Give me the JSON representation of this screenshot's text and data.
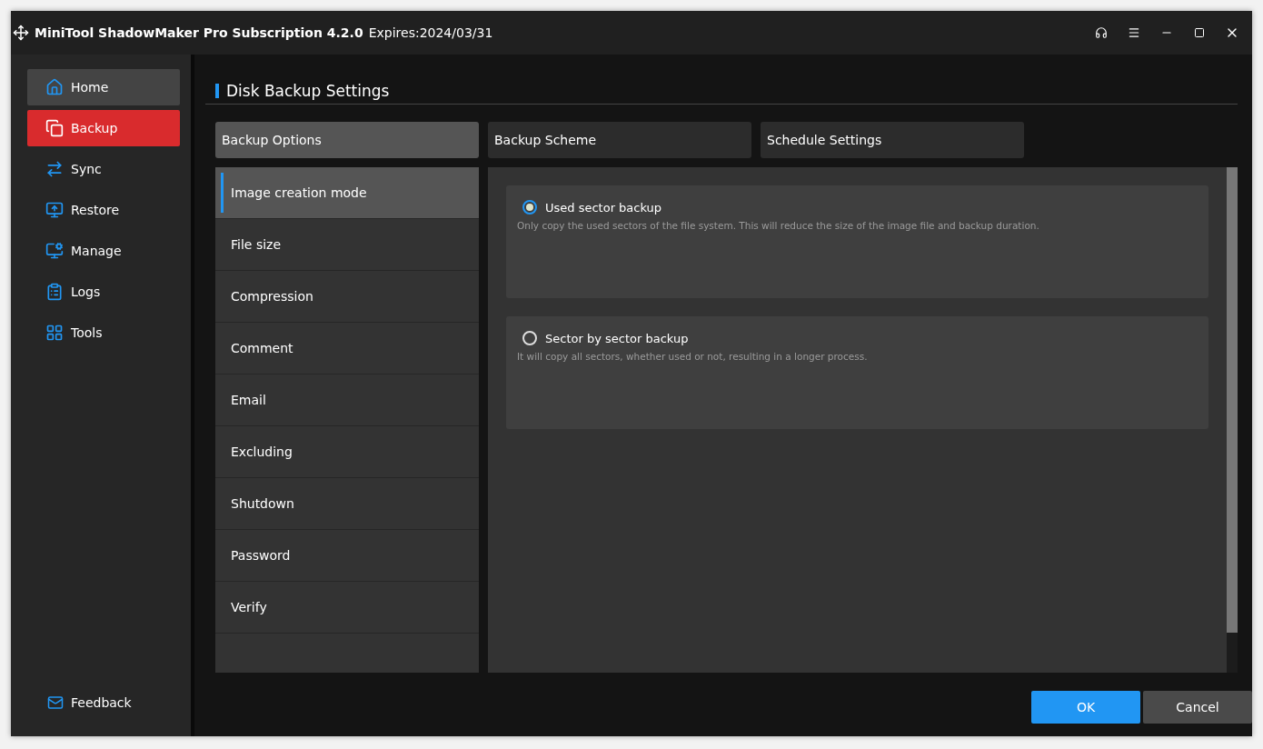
{
  "window": {
    "title": "MiniTool ShadowMaker Pro Subscription 4.2.0",
    "expiry": "Expires:2024/03/31"
  },
  "sidebar": {
    "items": [
      {
        "label": "Home",
        "selected": false,
        "hovered": true
      },
      {
        "label": "Backup",
        "selected": true,
        "hovered": false
      },
      {
        "label": "Sync",
        "selected": false,
        "hovered": false
      },
      {
        "label": "Restore",
        "selected": false,
        "hovered": false
      },
      {
        "label": "Manage",
        "selected": false,
        "hovered": false
      },
      {
        "label": "Logs",
        "selected": false,
        "hovered": false
      },
      {
        "label": "Tools",
        "selected": false,
        "hovered": false
      }
    ],
    "feedback": "Feedback"
  },
  "heading": "Disk Backup Settings",
  "tabs": [
    {
      "label": "Backup Options",
      "selected": true
    },
    {
      "label": "Backup Scheme",
      "selected": false
    },
    {
      "label": "Schedule Settings",
      "selected": false
    }
  ],
  "options_list": [
    {
      "label": "Image creation mode",
      "selected": true
    },
    {
      "label": "File size",
      "selected": false
    },
    {
      "label": "Compression",
      "selected": false
    },
    {
      "label": "Comment",
      "selected": false
    },
    {
      "label": "Email",
      "selected": false
    },
    {
      "label": "Excluding",
      "selected": false
    },
    {
      "label": "Shutdown",
      "selected": false
    },
    {
      "label": "Password",
      "selected": false
    },
    {
      "label": "Verify",
      "selected": false
    }
  ],
  "modes": [
    {
      "label": "Used sector backup",
      "description": "Only copy the used sectors of the file system. This will reduce the size of the image file and backup duration.",
      "selected": true
    },
    {
      "label": "Sector by sector backup",
      "description": "It will copy all sectors, whether used or not, resulting in a longer process.",
      "selected": false
    }
  ],
  "buttons": {
    "ok": "OK",
    "cancel": "Cancel"
  }
}
